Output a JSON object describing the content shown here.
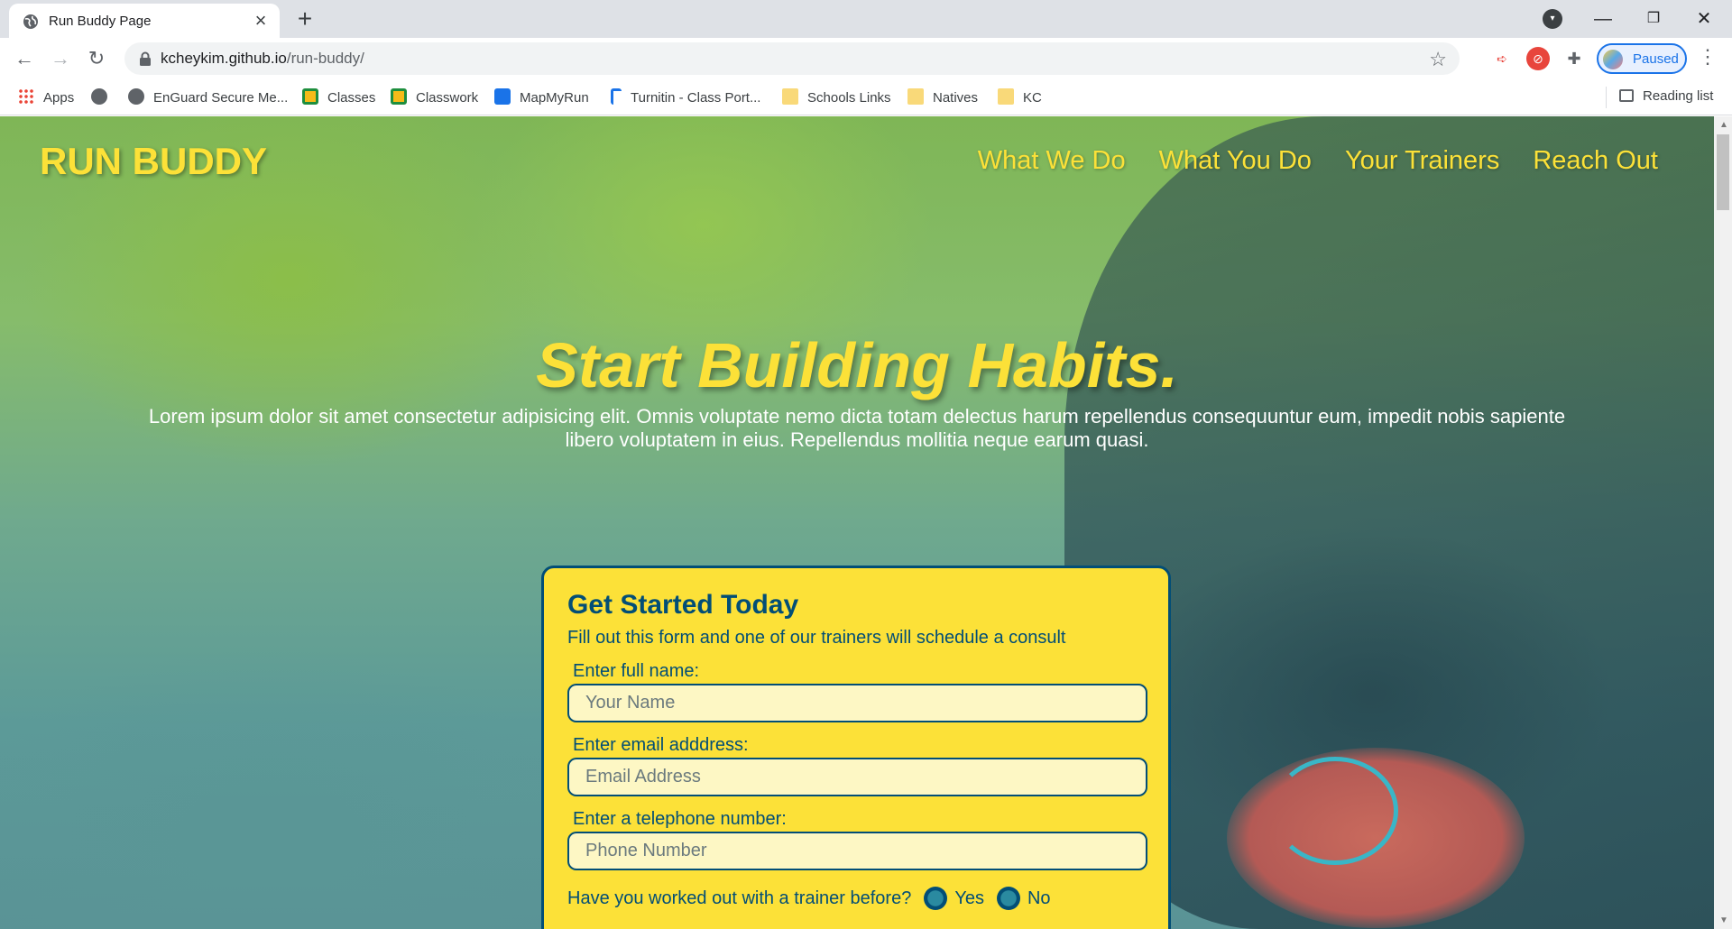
{
  "browser": {
    "tab_title": "Run Buddy Page",
    "url_host": "kcheykim.github.io",
    "url_path": "/run-buddy/",
    "profile_label": "Paused",
    "reading_list": "Reading list"
  },
  "bookmarks": [
    {
      "label": "Apps",
      "icon": "apps-icon"
    },
    {
      "label": "",
      "icon": "globe-icon"
    },
    {
      "label": "EnGuard Secure Me...",
      "icon": "globe-icon"
    },
    {
      "label": "Classes",
      "icon": "classroom-icon"
    },
    {
      "label": "Classwork",
      "icon": "classroom-icon"
    },
    {
      "label": "MapMyRun",
      "icon": "mapmyrun-icon"
    },
    {
      "label": "Turnitin - Class Port...",
      "icon": "turnitin-icon"
    },
    {
      "label": "Schools Links",
      "icon": "folder-icon"
    },
    {
      "label": "Natives",
      "icon": "folder-icon"
    },
    {
      "label": "KC",
      "icon": "folder-icon"
    }
  ],
  "site": {
    "logo": "RUN BUDDY",
    "nav": [
      "What We Do",
      "What You Do",
      "Your Trainers",
      "Reach Out"
    ],
    "hero_title": "Start Building Habits.",
    "hero_text": "Lorem ipsum dolor sit amet consectetur adipisicing elit. Omnis voluptate nemo dicta totam delectus harum repellendus consequuntur eum, impedit nobis sapiente libero voluptatem in eius. Repellendus mollitia neque earum quasi.",
    "form": {
      "title": "Get Started Today",
      "subtitle": "Fill out this form and one of our trainers will schedule a consult",
      "name_label": "Enter full name:",
      "name_placeholder": "Your Name",
      "email_label": "Enter email adddress:",
      "email_placeholder": "Email Address",
      "phone_label": "Enter a telephone number:",
      "phone_placeholder": "Phone Number",
      "trainer_question": "Have you worked out with a trainer before?",
      "yes_label": "Yes",
      "no_label": "No"
    }
  },
  "colors": {
    "brand_yellow": "#fce138",
    "brand_blue": "#024e76"
  }
}
